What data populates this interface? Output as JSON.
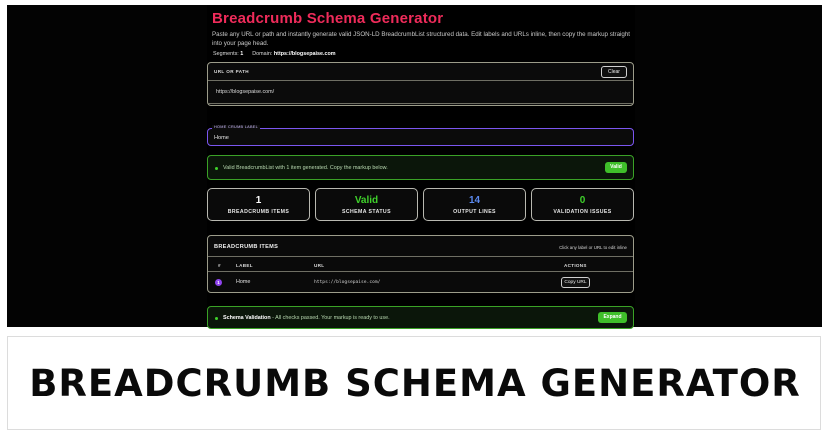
{
  "header": {
    "title": "Breadcrumb Schema Generator",
    "description": "Paste any URL or path and instantly generate valid JSON-LD BreadcrumbList structured data. Edit labels and URLs inline, then copy the markup straight into your page head."
  },
  "url_input": {
    "label": "URL OR PATH",
    "clear_label": "Clear",
    "value": "https://blogsepaise.com/",
    "segments_label": "Segments:",
    "segments_value": "1",
    "domain_label": "Domain:",
    "domain_value": "https://blogsepaise.com"
  },
  "home_label": {
    "tag": "HOME CRUMB LABEL",
    "value": "Home"
  },
  "status": {
    "message": "Valid BreadcrumbList with 1 item generated. Copy the markup below.",
    "badge": "Valid"
  },
  "stats": [
    {
      "value": "1",
      "label": "BREADCRUMB ITEMS",
      "color": "#ffffff"
    },
    {
      "value": "Valid",
      "label": "SCHEMA STATUS",
      "color": "#3fd12b"
    },
    {
      "value": "14",
      "label": "OUTPUT LINES",
      "color": "#5b8af0"
    },
    {
      "value": "0",
      "label": "VALIDATION ISSUES",
      "color": "#3fd12b"
    }
  ],
  "items_table": {
    "title": "BREADCRUMB ITEMS",
    "hint": "Click any label or URL to edit inline",
    "columns": {
      "index": "#",
      "label": "LABEL",
      "url": "URL",
      "actions": "ACTIONS"
    },
    "rows": [
      {
        "index": "1",
        "label": "Home",
        "url": "https://blogsepaise.com/",
        "action": "Copy URL"
      }
    ]
  },
  "validation": {
    "title": "Schema Validation",
    "message": " - All checks passed. Your markup is ready to use.",
    "expand_label": "Expand"
  },
  "banner": {
    "text": "BREADCRUMB SCHEMA GENERATOR"
  },
  "colors": {
    "accent_title": "#ee2b5a",
    "success": "#3fbf2a",
    "focus_border": "#7b56f0",
    "index_badge": "#8f43ef"
  }
}
